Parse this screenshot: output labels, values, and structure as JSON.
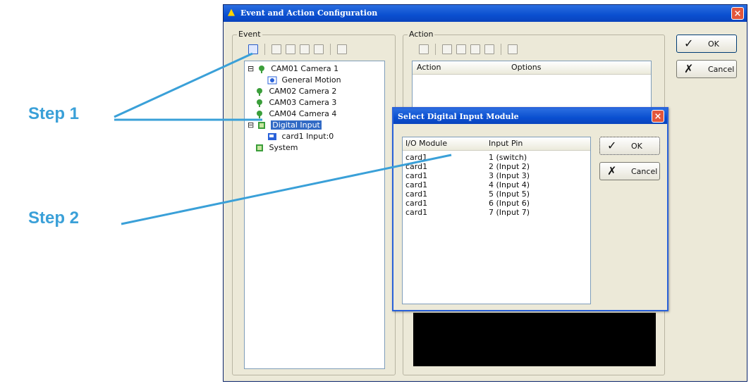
{
  "callouts": {
    "step1": "Step 1",
    "step2": "Step 2"
  },
  "main_window": {
    "title": "Event and Action Configuration",
    "event_group": "Event",
    "action_group": "Action",
    "event_tree": [
      {
        "label": "CAM01 Camera 1",
        "level": 0,
        "icon": "camera-icon"
      },
      {
        "label": "General Motion",
        "level": 1,
        "icon": "motion-icon"
      },
      {
        "label": "CAM02 Camera 2",
        "level": 0,
        "icon": "camera-icon"
      },
      {
        "label": "CAM03 Camera 3",
        "level": 0,
        "icon": "camera-icon"
      },
      {
        "label": "CAM04 Camera 4",
        "level": 0,
        "icon": "camera-icon"
      },
      {
        "label": "Digital Input",
        "level": 0,
        "icon": "digital-input-icon",
        "selected": true
      },
      {
        "label": "card1 Input:0",
        "level": 1,
        "icon": "input-pin-icon"
      },
      {
        "label": "System",
        "level": 0,
        "icon": "system-icon"
      }
    ],
    "action_columns": {
      "action": "Action",
      "options": "Options"
    },
    "buttons": {
      "ok": "OK",
      "cancel": "Cancel"
    }
  },
  "dialog": {
    "title": "Select Digital Input Module",
    "columns": {
      "module": "I/O Module",
      "pin": "Input Pin"
    },
    "rows": [
      {
        "module": "card1",
        "pin": "1 (switch)"
      },
      {
        "module": "card1",
        "pin": "2 (Input 2)"
      },
      {
        "module": "card1",
        "pin": "3 (Input 3)"
      },
      {
        "module": "card1",
        "pin": "4 (Input 4)"
      },
      {
        "module": "card1",
        "pin": "5 (Input 5)"
      },
      {
        "module": "card1",
        "pin": "6 (Input 6)"
      },
      {
        "module": "card1",
        "pin": "7 (Input 7)"
      }
    ],
    "buttons": {
      "ok": "OK",
      "cancel": "Cancel"
    }
  },
  "colors": {
    "callout": "#3aa0d8",
    "titlebar": "#0a4fd0",
    "selection": "#316ac5"
  }
}
